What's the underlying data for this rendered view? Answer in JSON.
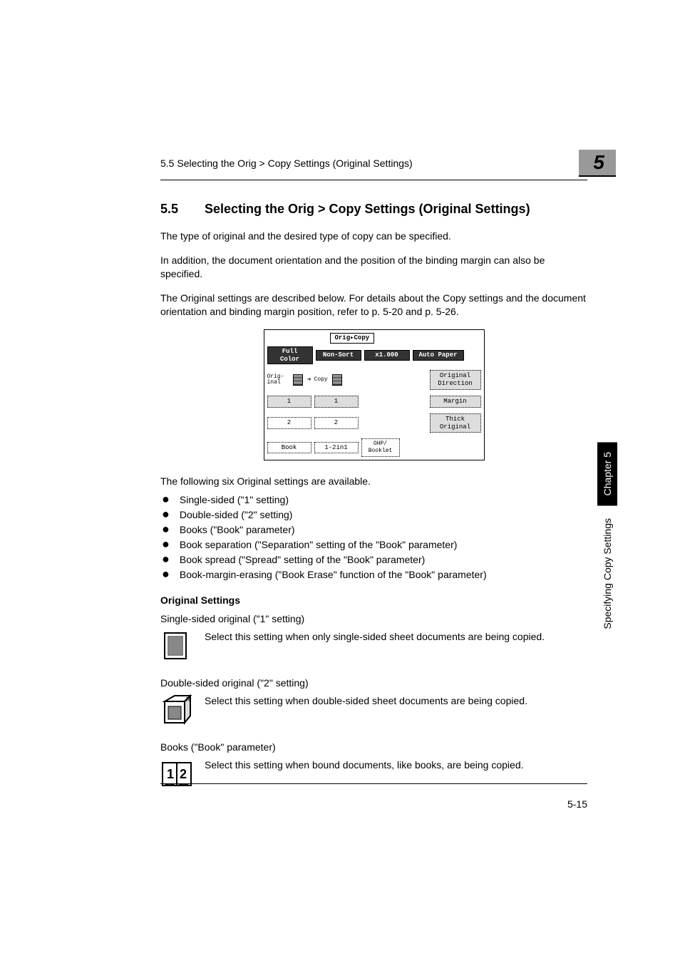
{
  "header": {
    "running_title": "5.5 Selecting the Orig > Copy Settings (Original Settings)",
    "chapter_number": "5"
  },
  "section": {
    "number": "5.5",
    "title": "Selecting the Orig > Copy Settings (Original Settings)"
  },
  "paragraphs": {
    "p1": "The type of original and the desired type of copy can be specified.",
    "p2": "In addition, the document orientation and the position of the binding margin can also be specified.",
    "p3": "The Original settings are described below. For details about the Copy settings and the document orientation and binding margin position, refer to p. 5-20 and p. 5-26."
  },
  "lcd": {
    "title": "Orig▸Copy",
    "full_color": "Full\nColor",
    "non_sort": "Non-Sort",
    "zoom": "x1.000",
    "auto_paper": "Auto Paper",
    "orig_label": "Orig-\ninal",
    "copy_label": "Copy",
    "orig_direction": "Original\nDirection",
    "margin": "Margin",
    "thick_original": "Thick\nOriginal",
    "one_a": "1",
    "one_b": "1",
    "two_a": "2",
    "two_b": "2",
    "book": "Book",
    "one_2in1": "1-2in1",
    "ohp_booklet": "OHP/\nBooklet"
  },
  "intro_list": "The following six Original settings are available.",
  "bullets": [
    "Single-sided (\"1\" setting)",
    "Double-sided (\"2\" setting)",
    "Books (\"Book\" parameter)",
    "Book separation (\"Separation\" setting of the \"Book\" parameter)",
    "Book spread (\"Spread\" setting of the \"Book\" parameter)",
    "Book-margin-erasing (\"Book Erase\" function of the \"Book\" parameter)"
  ],
  "original_settings_heading": "Original Settings",
  "settings": {
    "single": {
      "title": "Single-sided original (\"1\" setting)",
      "desc": "Select this setting when only single-sided sheet documents are being copied."
    },
    "double": {
      "title": "Double-sided original (\"2\" setting)",
      "desc": "Select this setting when double-sided sheet documents are being copied."
    },
    "books": {
      "title": "Books (\"Book\" parameter)",
      "desc": "Select this setting when bound documents, like books, are being copied."
    }
  },
  "footer": {
    "page_number": "5-15"
  },
  "side": {
    "chapter": "Chapter 5",
    "label": "Specifying Copy Settings"
  }
}
